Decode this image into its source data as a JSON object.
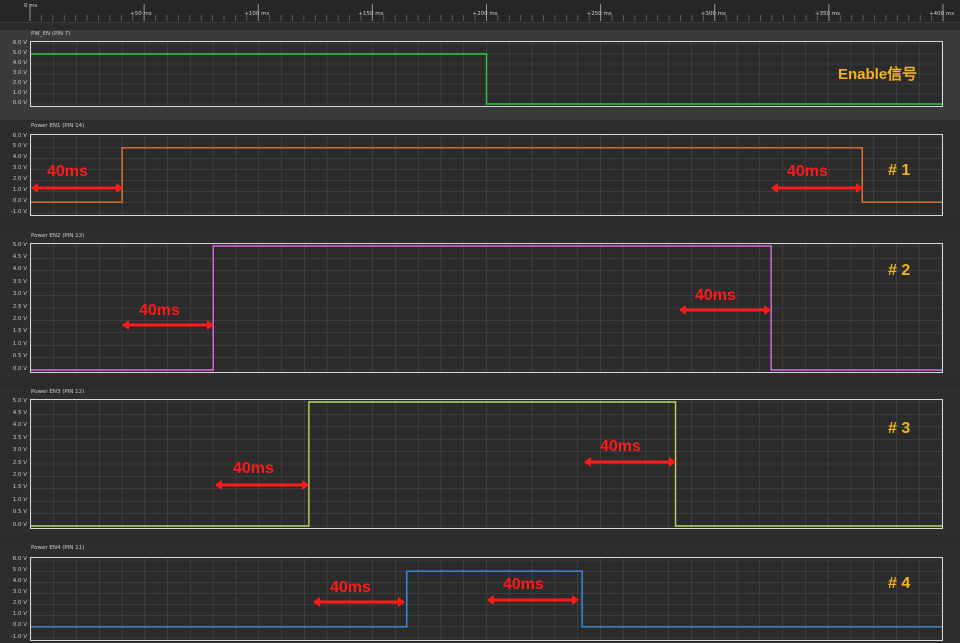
{
  "ruler": {
    "ticks": [
      "0 ms",
      "+50 ms",
      "+100 ms",
      "+150 ms",
      "+200 ms",
      "+250 ms",
      "+300 ms",
      "+350 ms",
      "+400 ms"
    ]
  },
  "channels": [
    {
      "title": "PW_EN (PIN 7)",
      "color": "#2ecc40",
      "yticks": [
        "6.0 V",
        "5.0 V",
        "4.0 V",
        "3.0 V",
        "2.0 V",
        "1.0 V",
        "0.0 V"
      ],
      "tag": "Enable信号"
    },
    {
      "title": "Power EN1 (PIN 14)",
      "color": "#e8772e",
      "yticks": [
        "6.0 V",
        "5.0 V",
        "4.0 V",
        "3.0 V",
        "2.0 V",
        "1.0 V",
        "0.0 V",
        "-1.0 V"
      ],
      "tag": "# 1"
    },
    {
      "title": "Power EN2 (PIN 13)",
      "color": "#e06be0",
      "yticks": [
        "5.0 V",
        "4.5 V",
        "4.0 V",
        "3.5 V",
        "3.0 V",
        "2.5 V",
        "2.0 V",
        "1.5 V",
        "1.0 V",
        "0.5 V",
        "0.0 V"
      ],
      "tag": "# 2"
    },
    {
      "title": "Power EN3 (PIN 12)",
      "color": "#b7dc5a",
      "yticks": [
        "5.0 V",
        "4.5 V",
        "4.0 V",
        "3.5 V",
        "3.0 V",
        "2.5 V",
        "2.0 V",
        "1.5 V",
        "1.0 V",
        "0.5 V",
        "0.0 V"
      ],
      "tag": "# 3"
    },
    {
      "title": "Power EN4 (PIN 11)",
      "color": "#3b8fe6",
      "yticks": [
        "6.0 V",
        "5.0 V",
        "4.0 V",
        "3.0 V",
        "2.0 V",
        "1.0 V",
        "0.0 V",
        "-1.0 V"
      ],
      "tag": "# 4"
    }
  ],
  "signals": {
    "pw_en": {
      "high_v": 5.0,
      "rise_ms": 0,
      "fall_ms": 200
    },
    "en1": {
      "high_v": 5.0,
      "rise_ms": 40,
      "fall_ms": 365
    },
    "en2": {
      "high_v": 5.0,
      "rise_ms": 80,
      "fall_ms": 325
    },
    "en3": {
      "high_v": 5.0,
      "rise_ms": 122,
      "fall_ms": 283
    },
    "en4": {
      "high_v": 5.0,
      "rise_ms": 165,
      "fall_ms": 242
    }
  },
  "annotations": {
    "delay_label": "40ms"
  },
  "colors": {
    "annotation": "#ff1a1a",
    "tag": "#f5b31a",
    "grid": "#4a4a4a"
  }
}
